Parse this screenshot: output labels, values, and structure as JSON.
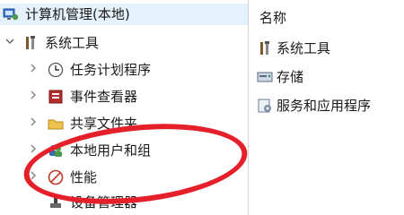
{
  "tree": {
    "root": {
      "label": "计算机管理(本地)",
      "icon": "computer-management-icon"
    },
    "system_tools": {
      "label": "系统工具",
      "icon": "tools-icon",
      "expanded": true
    },
    "children": [
      {
        "label": "任务计划程序",
        "icon": "clock-icon"
      },
      {
        "label": "事件查看器",
        "icon": "event-viewer-icon"
      },
      {
        "label": "共享文件夹",
        "icon": "shared-folder-icon"
      },
      {
        "label": "本地用户和组",
        "icon": "users-icon"
      },
      {
        "label": "性能",
        "icon": "performance-icon"
      },
      {
        "label": "设备管理器",
        "icon": "device-manager-icon"
      }
    ]
  },
  "list": {
    "column_header": "名称",
    "items": [
      {
        "label": "系统工具",
        "icon": "tools-icon"
      },
      {
        "label": "存储",
        "icon": "storage-icon"
      },
      {
        "label": "服务和应用程序",
        "icon": "services-icon"
      }
    ]
  },
  "annotation": {
    "color": "#e5202a"
  }
}
